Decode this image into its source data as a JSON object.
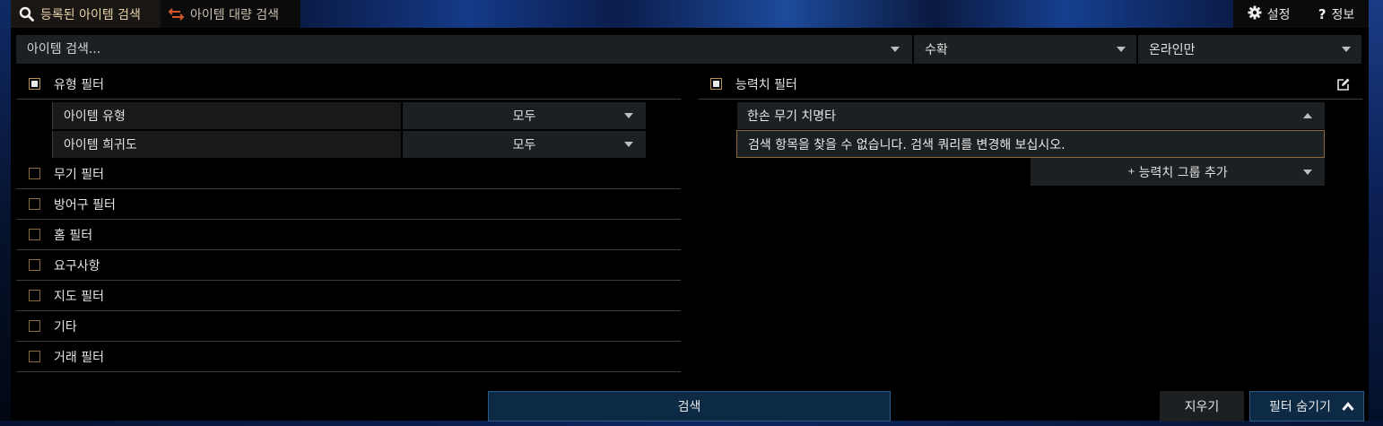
{
  "tabs": [
    {
      "label": "등록된 아이템 검색",
      "icon": "search-icon",
      "active": true
    },
    {
      "label": "아이템 대량 검색",
      "icon": "exchange-arrows-icon",
      "active": false
    }
  ],
  "top_links": {
    "settings": {
      "label": "설정",
      "icon": "gear-icon"
    },
    "about": {
      "label": "정보",
      "icon": "question-icon"
    }
  },
  "search": {
    "placeholder": "아이템 검색...",
    "status_select": "수확",
    "online_select": "온라인만"
  },
  "type_filter": {
    "label": "유형 필터",
    "checked": true,
    "rows": [
      {
        "label": "아이템 유형",
        "value": "모두"
      },
      {
        "label": "아이템 희귀도",
        "value": "모두"
      }
    ]
  },
  "filter_groups": [
    {
      "label": "무기 필터",
      "checked": false
    },
    {
      "label": "방어구 필터",
      "checked": false
    },
    {
      "label": "홈 필터",
      "checked": false
    },
    {
      "label": "요구사항",
      "checked": false
    },
    {
      "label": "지도 필터",
      "checked": false
    },
    {
      "label": "기타",
      "checked": false
    },
    {
      "label": "거래 필터",
      "checked": false
    }
  ],
  "stat_filter": {
    "label": "능력치 필터",
    "checked": true,
    "input_value": "한손 무기 치명타",
    "no_results": "검색 항목을 찾을 수 없습니다. 검색 쿼리를 변경해 보십시오.",
    "add_group": "능력치 그룹 추가",
    "add_prefix": "+"
  },
  "buttons": {
    "search": "검색",
    "clear": "지우기",
    "hide_filters": "필터 숨기기"
  },
  "colors": {
    "accent_gold": "#b48d57",
    "button_blue": "#0d2a44",
    "panel_gray": "#1d2023"
  }
}
